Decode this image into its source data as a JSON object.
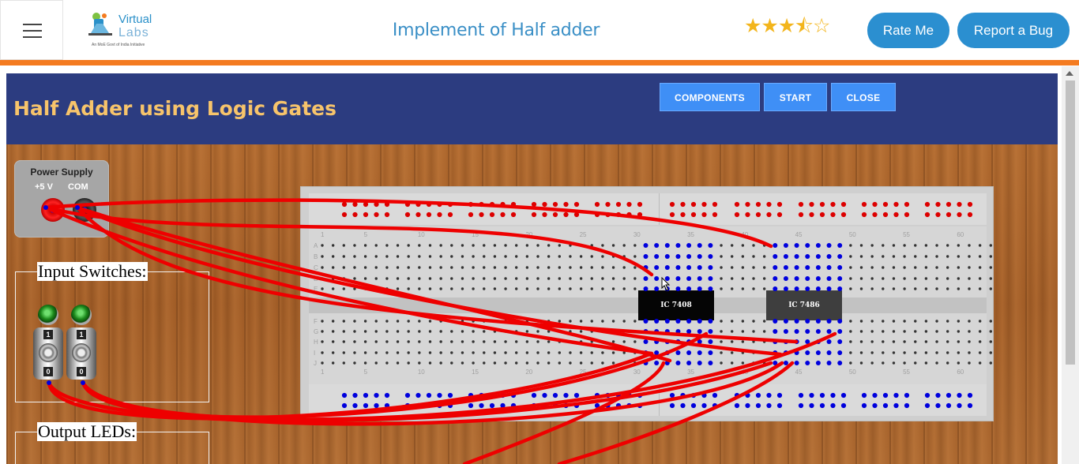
{
  "header": {
    "menu_icon": "hamburger-menu-icon",
    "logo": {
      "line1": "Virtual",
      "line2": "Labs",
      "tagline": "An MoE Govt of India Initiative"
    },
    "title": "Implement of Half adder",
    "rating": {
      "value": 3.5,
      "max": 5
    },
    "rate_label": "Rate Me",
    "bug_label": "Report a Bug",
    "colors": {
      "accent": "#2b8fd0",
      "orange_bar": "#f47b20",
      "title": "#3a8fc6"
    }
  },
  "sim": {
    "title": "Half Adder using Logic Gates",
    "buttons": {
      "components": "COMPONENTS",
      "start": "START",
      "close": "CLOSE"
    },
    "power_supply": {
      "title": "Power Supply",
      "plus": "+5 V",
      "com": "COM"
    },
    "input_switches": "Input Switches:",
    "output_leds": "Output LEDs:",
    "switch_top": "1",
    "switch_bottom": "0",
    "ic1": "IC 7408",
    "ic2": "IC 7486",
    "row_labels": [
      "A",
      "B",
      "C",
      "D",
      "E",
      "F",
      "G",
      "H",
      "I",
      "J"
    ],
    "col_labels": [
      "1",
      "5",
      "10",
      "15",
      "20",
      "25",
      "30",
      "35",
      "40",
      "45",
      "50",
      "55",
      "60"
    ],
    "colors": {
      "header_bg": "#2c3c80",
      "title": "#f7c46b",
      "button": "#3f8ff6",
      "wire": "#ee0000",
      "active_hole": "#0000dd"
    }
  }
}
